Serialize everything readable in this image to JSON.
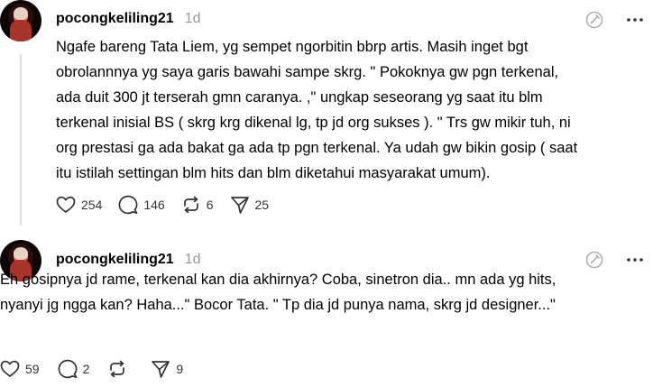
{
  "posts": [
    {
      "username": "pocongkeliling21",
      "timestamp": "1d",
      "text": "Ngafe bareng Tata Liem, yg sempet ngorbitin bbrp artis. Masih inget bgt\nobrolannnya yg saya garis bawahi sampe skrg. \" Pokoknya gw pgn terkenal,\nada duit 300 jt terserah gmn caranya. ,\" ungkap seseorang yg saat itu blm\nterkenal inisial BS ( skrg krg dikenal lg, tp jd org sukses ). \" Trs gw mikir tuh, ni\norg prestasi ga ada bakat ga ada tp pgn terkenal. Ya udah gw bikin gosip ( saat\nitu istilah settingan blm hits dan blm diketahui masyarakat umum).",
      "likes": "254",
      "replies": "146",
      "reposts": "6",
      "shares": "25"
    },
    {
      "username": "pocongkeliling21",
      "timestamp": "1d",
      "text": "Eh gosipnya jd rame, terkenal kan dia akhirnya? Coba, sinetron dia.. mn ada yg hits,\nnyanyi jg ngga kan? Haha...\" Bocor Tata. \" Tp dia jd punya nama, skrg jd designer...\"",
      "likes": "59",
      "replies": "2",
      "reposts": "",
      "shares": "9"
    }
  ],
  "icons": {
    "like": "heart-icon",
    "reply": "comment-icon",
    "repost": "repost-icon",
    "share": "send-icon",
    "edit": "edit-disabled-icon",
    "more": "more-icon"
  },
  "colors": {
    "text": "#000000",
    "muted": "#999999",
    "icon": "#333333",
    "thread_line": "#dcdcdc"
  }
}
